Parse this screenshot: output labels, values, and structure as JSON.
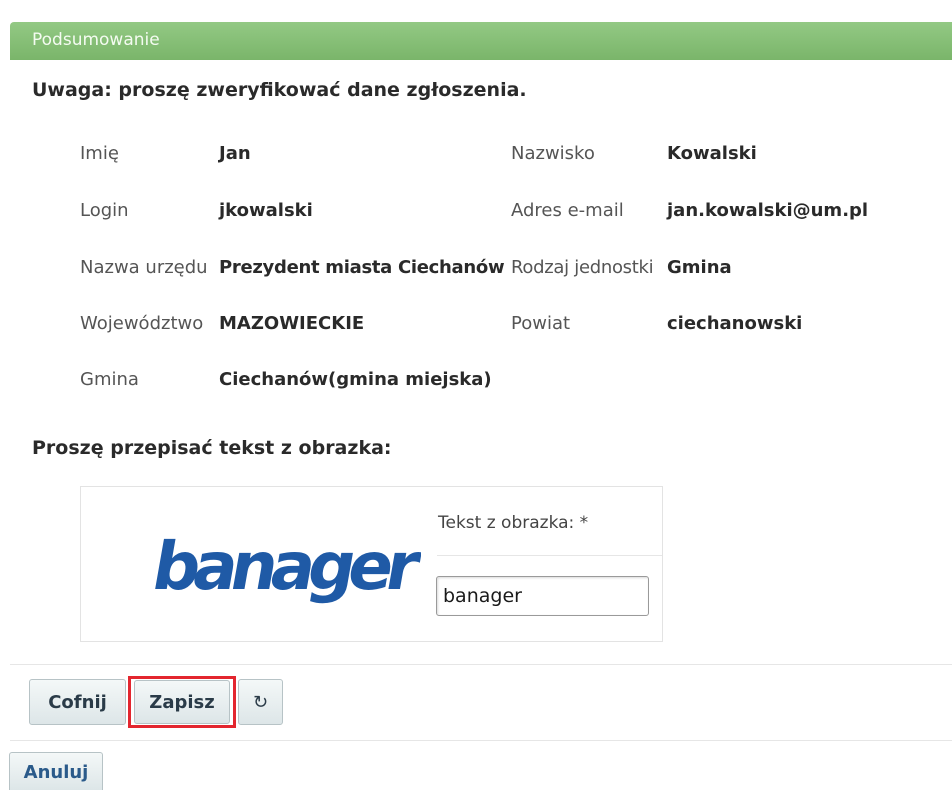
{
  "header": {
    "title": "Podsumowanie"
  },
  "notice": "Uwaga: proszę zweryfikować dane zgłoszenia.",
  "fields": {
    "first_name": {
      "label": "Imię",
      "value": "Jan"
    },
    "last_name": {
      "label": "Nazwisko",
      "value": "Kowalski"
    },
    "login": {
      "label": "Login",
      "value": "jkowalski"
    },
    "email": {
      "label": "Adres e-mail",
      "value": "jan.kowalski@um.pl"
    },
    "office": {
      "label": "Nazwa urzędu",
      "value": "Prezydent miasta Ciechanów"
    },
    "unit_type": {
      "label": "Rodzaj jednostki",
      "value": "Gmina"
    },
    "voivodeship": {
      "label": "Województwo",
      "value": "MAZOWIECKIE"
    },
    "county": {
      "label": "Powiat",
      "value": "ciechanowski"
    },
    "commune": {
      "label": "Gmina",
      "value": "Ciechanów(gmina miejska)"
    }
  },
  "captcha": {
    "heading": "Proszę przepisać tekst z obrazka:",
    "image_text": "banager",
    "image_color": "#1f5aa6",
    "label": "Tekst z obrazka: *",
    "input_value": "banager"
  },
  "buttons": {
    "back": "Cofnij",
    "save": "Zapisz",
    "refresh_icon": "↻",
    "cancel": "Anuluj"
  },
  "colors": {
    "header_green": "#86c075",
    "highlight_red": "#e3262f"
  }
}
